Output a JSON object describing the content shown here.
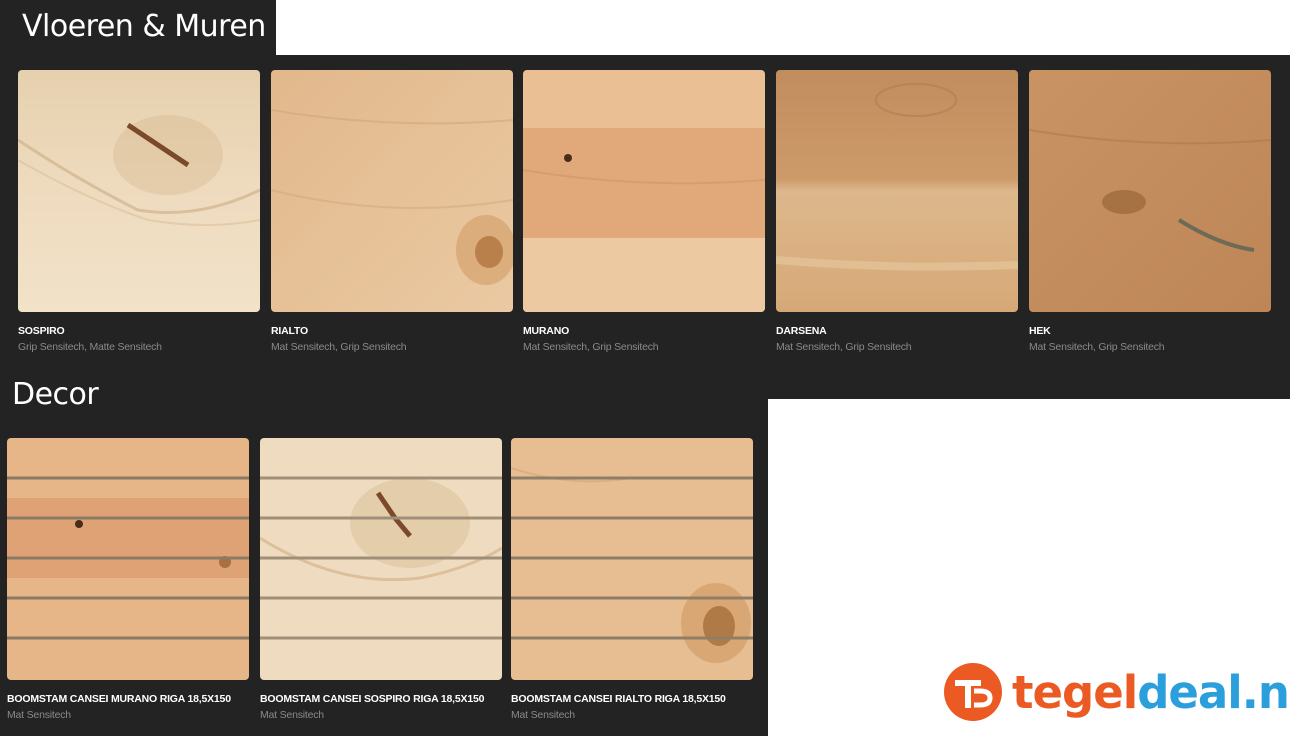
{
  "sections": {
    "floors_walls": {
      "title": "Vloeren & Muren",
      "items": [
        {
          "name": "SOSPIRO",
          "finish": "Grip Sensitech, Matte Sensitech"
        },
        {
          "name": "RIALTO",
          "finish": "Mat Sensitech, Grip Sensitech"
        },
        {
          "name": "MURANO",
          "finish": "Mat Sensitech, Grip Sensitech"
        },
        {
          "name": "DARSENA",
          "finish": "Mat Sensitech, Grip Sensitech"
        },
        {
          "name": "HEK",
          "finish": "Mat Sensitech, Grip Sensitech"
        }
      ]
    },
    "decor": {
      "title": "Decor",
      "items": [
        {
          "name": "BOOMSTAM CANSEI MURANO RIGA 18,5X150",
          "finish": "Mat Sensitech"
        },
        {
          "name": "BOOMSTAM CANSEI SOSPIRO RIGA 18,5X150",
          "finish": "Mat Sensitech"
        },
        {
          "name": "BOOMSTAM CANSEI RIALTO RIGA 18,5X150",
          "finish": "Mat Sensitech"
        }
      ]
    }
  },
  "logo": {
    "part1": "tegel",
    "part2": "deal.nl"
  },
  "colors": {
    "panel": "#232323",
    "logo_orange": "#ec5a24",
    "logo_blue": "#2b9fdc"
  }
}
